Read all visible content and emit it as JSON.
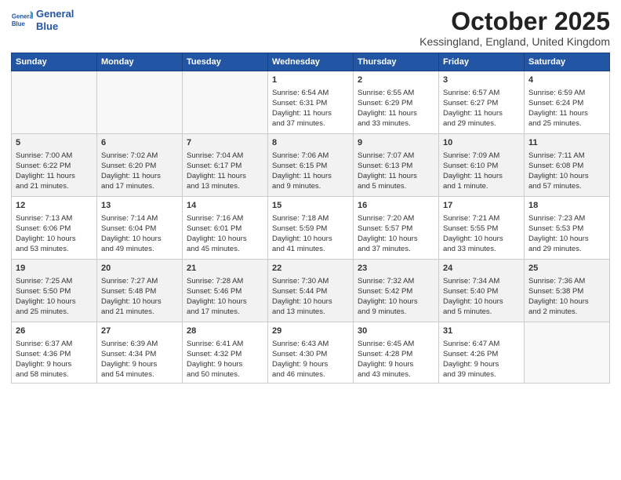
{
  "header": {
    "logo_line1": "General",
    "logo_line2": "Blue",
    "month": "October 2025",
    "location": "Kessingland, England, United Kingdom"
  },
  "weekdays": [
    "Sunday",
    "Monday",
    "Tuesday",
    "Wednesday",
    "Thursday",
    "Friday",
    "Saturday"
  ],
  "weeks": [
    [
      {
        "day": "",
        "info": "",
        "empty": true
      },
      {
        "day": "",
        "info": "",
        "empty": true
      },
      {
        "day": "",
        "info": "",
        "empty": true
      },
      {
        "day": "1",
        "info": "Sunrise: 6:54 AM\nSunset: 6:31 PM\nDaylight: 11 hours\nand 37 minutes."
      },
      {
        "day": "2",
        "info": "Sunrise: 6:55 AM\nSunset: 6:29 PM\nDaylight: 11 hours\nand 33 minutes."
      },
      {
        "day": "3",
        "info": "Sunrise: 6:57 AM\nSunset: 6:27 PM\nDaylight: 11 hours\nand 29 minutes."
      },
      {
        "day": "4",
        "info": "Sunrise: 6:59 AM\nSunset: 6:24 PM\nDaylight: 11 hours\nand 25 minutes."
      }
    ],
    [
      {
        "day": "5",
        "info": "Sunrise: 7:00 AM\nSunset: 6:22 PM\nDaylight: 11 hours\nand 21 minutes.",
        "shaded": true
      },
      {
        "day": "6",
        "info": "Sunrise: 7:02 AM\nSunset: 6:20 PM\nDaylight: 11 hours\nand 17 minutes.",
        "shaded": true
      },
      {
        "day": "7",
        "info": "Sunrise: 7:04 AM\nSunset: 6:17 PM\nDaylight: 11 hours\nand 13 minutes.",
        "shaded": true
      },
      {
        "day": "8",
        "info": "Sunrise: 7:06 AM\nSunset: 6:15 PM\nDaylight: 11 hours\nand 9 minutes.",
        "shaded": true
      },
      {
        "day": "9",
        "info": "Sunrise: 7:07 AM\nSunset: 6:13 PM\nDaylight: 11 hours\nand 5 minutes.",
        "shaded": true
      },
      {
        "day": "10",
        "info": "Sunrise: 7:09 AM\nSunset: 6:10 PM\nDaylight: 11 hours\nand 1 minute.",
        "shaded": true
      },
      {
        "day": "11",
        "info": "Sunrise: 7:11 AM\nSunset: 6:08 PM\nDaylight: 10 hours\nand 57 minutes.",
        "shaded": true
      }
    ],
    [
      {
        "day": "12",
        "info": "Sunrise: 7:13 AM\nSunset: 6:06 PM\nDaylight: 10 hours\nand 53 minutes."
      },
      {
        "day": "13",
        "info": "Sunrise: 7:14 AM\nSunset: 6:04 PM\nDaylight: 10 hours\nand 49 minutes."
      },
      {
        "day": "14",
        "info": "Sunrise: 7:16 AM\nSunset: 6:01 PM\nDaylight: 10 hours\nand 45 minutes."
      },
      {
        "day": "15",
        "info": "Sunrise: 7:18 AM\nSunset: 5:59 PM\nDaylight: 10 hours\nand 41 minutes."
      },
      {
        "day": "16",
        "info": "Sunrise: 7:20 AM\nSunset: 5:57 PM\nDaylight: 10 hours\nand 37 minutes."
      },
      {
        "day": "17",
        "info": "Sunrise: 7:21 AM\nSunset: 5:55 PM\nDaylight: 10 hours\nand 33 minutes."
      },
      {
        "day": "18",
        "info": "Sunrise: 7:23 AM\nSunset: 5:53 PM\nDaylight: 10 hours\nand 29 minutes."
      }
    ],
    [
      {
        "day": "19",
        "info": "Sunrise: 7:25 AM\nSunset: 5:50 PM\nDaylight: 10 hours\nand 25 minutes.",
        "shaded": true
      },
      {
        "day": "20",
        "info": "Sunrise: 7:27 AM\nSunset: 5:48 PM\nDaylight: 10 hours\nand 21 minutes.",
        "shaded": true
      },
      {
        "day": "21",
        "info": "Sunrise: 7:28 AM\nSunset: 5:46 PM\nDaylight: 10 hours\nand 17 minutes.",
        "shaded": true
      },
      {
        "day": "22",
        "info": "Sunrise: 7:30 AM\nSunset: 5:44 PM\nDaylight: 10 hours\nand 13 minutes.",
        "shaded": true
      },
      {
        "day": "23",
        "info": "Sunrise: 7:32 AM\nSunset: 5:42 PM\nDaylight: 10 hours\nand 9 minutes.",
        "shaded": true
      },
      {
        "day": "24",
        "info": "Sunrise: 7:34 AM\nSunset: 5:40 PM\nDaylight: 10 hours\nand 5 minutes.",
        "shaded": true
      },
      {
        "day": "25",
        "info": "Sunrise: 7:36 AM\nSunset: 5:38 PM\nDaylight: 10 hours\nand 2 minutes.",
        "shaded": true
      }
    ],
    [
      {
        "day": "26",
        "info": "Sunrise: 6:37 AM\nSunset: 4:36 PM\nDaylight: 9 hours\nand 58 minutes."
      },
      {
        "day": "27",
        "info": "Sunrise: 6:39 AM\nSunset: 4:34 PM\nDaylight: 9 hours\nand 54 minutes."
      },
      {
        "day": "28",
        "info": "Sunrise: 6:41 AM\nSunset: 4:32 PM\nDaylight: 9 hours\nand 50 minutes."
      },
      {
        "day": "29",
        "info": "Sunrise: 6:43 AM\nSunset: 4:30 PM\nDaylight: 9 hours\nand 46 minutes."
      },
      {
        "day": "30",
        "info": "Sunrise: 6:45 AM\nSunset: 4:28 PM\nDaylight: 9 hours\nand 43 minutes."
      },
      {
        "day": "31",
        "info": "Sunrise: 6:47 AM\nSunset: 4:26 PM\nDaylight: 9 hours\nand 39 minutes."
      },
      {
        "day": "",
        "info": "",
        "empty": true
      }
    ]
  ]
}
